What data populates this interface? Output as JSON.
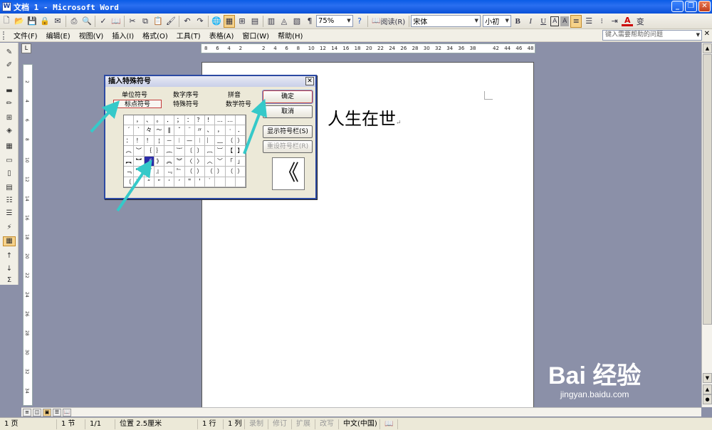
{
  "window": {
    "title": "文档 1 - Microsoft Word",
    "app_icon": "W"
  },
  "toolbar": {
    "zoom": "75%",
    "read_label": "阅读(R)",
    "font_name": "宋体",
    "font_size": "小初",
    "bold": "B",
    "italic": "I",
    "underline": "U",
    "char_border": "A",
    "char_shading": "A",
    "font_color_letter": "A",
    "pinyin_glyph": "变"
  },
  "menu": {
    "items": [
      "文件(F)",
      "编辑(E)",
      "视图(V)",
      "插入(I)",
      "格式(O)",
      "工具(T)",
      "表格(A)",
      "窗口(W)",
      "帮助(H)"
    ],
    "help_placeholder": "键入需要帮助的问题"
  },
  "ruler": {
    "h_ticks": [
      "8",
      "6",
      "4",
      "2",
      "",
      "2",
      "4",
      "6",
      "8",
      "10",
      "12",
      "14",
      "16",
      "18",
      "20",
      "22",
      "24",
      "26",
      "28",
      "30",
      "32",
      "34",
      "36",
      "38",
      "",
      "42",
      "44",
      "46",
      "48"
    ],
    "v_ticks": [
      "2",
      "4",
      "6",
      "8",
      "10",
      "12",
      "14",
      "16",
      "18",
      "20",
      "22",
      "24",
      "26",
      "28",
      "30",
      "32",
      "34"
    ]
  },
  "document": {
    "text": "人生在世",
    "para_mark": "↵"
  },
  "dialog": {
    "title": "插入特殊符号",
    "tabs_row1": [
      "单位符号",
      "数字序号",
      "拼音"
    ],
    "tabs_row2": [
      "标点符号",
      "特殊符号",
      "数学符号"
    ],
    "selected_tab": "标点符号",
    "grid": [
      [
        "",
        "，",
        "、",
        "。",
        "．",
        "；",
        "：",
        "？",
        "！",
        "…",
        "…",
        ""
      ],
      [
        "ˊ",
        "ˋ",
        "々",
        "～",
        "‖",
        "ˇ",
        "¨",
        "〃",
        "、",
        "，",
        "·",
        "．"
      ],
      [
        "：",
        "！",
        "！",
        "¦",
        "－",
        "︱",
        "—",
        "︱",
        "︴",
        "﹏",
        "（",
        "）"
      ],
      [
        "︵",
        "︶",
        "｛",
        "｝",
        "︷",
        "︸",
        "〔",
        "〕",
        "︹",
        "︺",
        "【",
        "】"
      ],
      [
        "︻",
        "︼",
        "《",
        "》",
        "︽",
        "︾",
        "〈",
        "〉",
        "︿",
        "﹀",
        "「",
        "」"
      ],
      [
        "﹁",
        "﹂",
        "『",
        "』",
        "﹃",
        "﹄",
        "（",
        "）",
        "（",
        "）",
        "（",
        "）"
      ],
      [
        "〔",
        "〕",
        "“",
        "”",
        "‘",
        "’",
        "＂",
        "＇",
        "｀",
        "",
        "",
        ""
      ]
    ],
    "ok": "确定",
    "cancel": "取消",
    "show_bar": "显示符号栏(S)",
    "reset_bar": "重设符号栏(R)",
    "preview": "《"
  },
  "status": {
    "page": "1 页",
    "section": "1 节",
    "pages": "1/1",
    "position": "位置 2.5厘米",
    "line": "1 行",
    "column": "1 列",
    "rec": "录制",
    "trk": "修订",
    "ext": "扩展",
    "ovr": "改写",
    "lang": "中文(中国)"
  },
  "watermark": {
    "main": "Bai 经验",
    "sub": "jingyan.baidu.com"
  },
  "colors": {
    "title_blue": "#0a5ce6",
    "arrow": "#35c9c9",
    "selected_cell": "#2a2aa8",
    "ok_border": "#c43b3b"
  }
}
